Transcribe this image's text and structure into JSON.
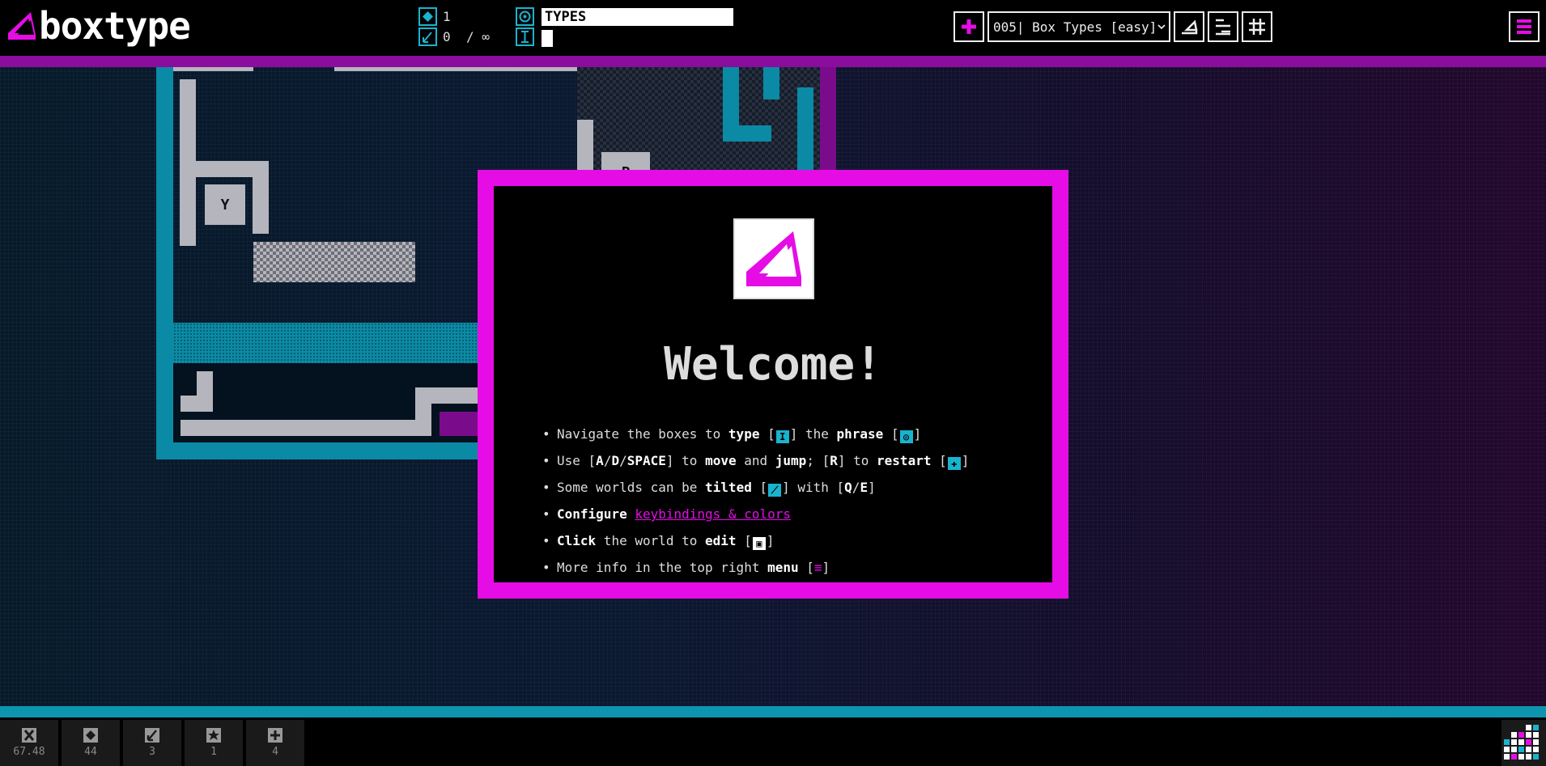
{
  "app": {
    "name": "boxtype"
  },
  "topbar": {
    "count_value": "1",
    "tilt_value": "0",
    "tilt_limit": "/ ∞",
    "phrase": "TYPES",
    "typed": "",
    "level_select": "005| Box Types [easy]",
    "icons": {
      "phrase_icon": "target-icon",
      "typed_icon": "cursor-icon",
      "count_icon": "diamond-icon",
      "tilt_icon": "tilt-icon"
    }
  },
  "world": {
    "letters": [
      "Y",
      "P"
    ]
  },
  "help": {
    "label": "[?]"
  },
  "modal": {
    "title": "Welcome!",
    "lines": {
      "l1": {
        "a": "Navigate the boxes to ",
        "b": "type",
        "c": " [",
        "d": "] the ",
        "e": "phrase",
        "f": " [",
        "g": "]"
      },
      "l2": {
        "a": "Use [",
        "b": "A",
        "c": "/",
        "d": "D",
        "e": "/",
        "f": "SPACE",
        "g": "] to ",
        "h": "move",
        "i": " and ",
        "j": "jump",
        "k": "; [",
        "l": "R",
        "m": "] to ",
        "n": "restart",
        "o": " [",
        "p": "]"
      },
      "l3": {
        "a": "Some worlds can be ",
        "b": "tilted",
        "c": " [",
        "d": "] with [",
        "e": "Q",
        "f": "/",
        "g": "E",
        "h": "]"
      },
      "l4": {
        "a": "Configure",
        "b": " ",
        "c": "keybindings & colors"
      },
      "l5": {
        "a": "Click",
        "b": " the world to ",
        "c": "edit",
        "d": " [",
        "e": "]"
      },
      "l6": {
        "a": "More info in the top right ",
        "b": "menu",
        "c": " [",
        "d": "≡",
        "e": "]"
      }
    }
  },
  "bottom": {
    "stats": [
      {
        "icon": "hourglass-icon",
        "value": "67.48"
      },
      {
        "icon": "diamond-icon",
        "value": "44"
      },
      {
        "icon": "tilt-icon",
        "value": "3"
      },
      {
        "icon": "star-icon",
        "value": "1"
      },
      {
        "icon": "plus-icon",
        "value": "4"
      }
    ]
  },
  "colors": {
    "accent_magenta": "#e60ce6",
    "accent_teal": "#1ab3cf",
    "strip_magenta": "#8a0d9e",
    "strip_teal": "#0d95b0"
  }
}
